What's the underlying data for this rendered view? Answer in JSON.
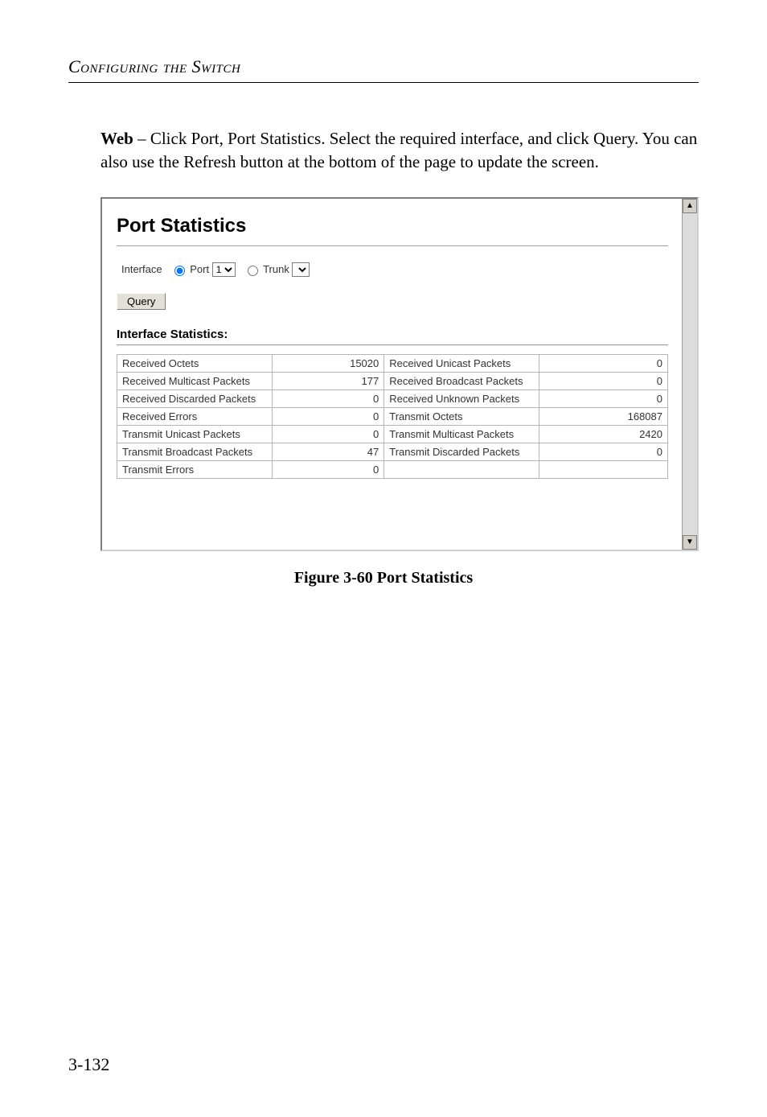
{
  "header": {
    "title": "Configuring the Switch"
  },
  "body": {
    "lead": "Web",
    "text": " – Click Port, Port Statistics. Select the required interface, and click Query. You can also use the Refresh button at the bottom of the page to update the screen."
  },
  "ui": {
    "heading": "Port Statistics",
    "interface_label": "Interface",
    "port_radio_label": "Port",
    "port_select_value": "1",
    "trunk_radio_label": "Trunk",
    "trunk_select_value": "",
    "query_button": "Query",
    "section_heading": "Interface Statistics:",
    "stats_rows": [
      {
        "l1": "Received Octets",
        "v1": "15020",
        "l2": "Received Unicast Packets",
        "v2": "0"
      },
      {
        "l1": "Received Multicast Packets",
        "v1": "177",
        "l2": "Received Broadcast Packets",
        "v2": "0"
      },
      {
        "l1": "Received Discarded Packets",
        "v1": "0",
        "l2": "Received Unknown Packets",
        "v2": "0"
      },
      {
        "l1": "Received Errors",
        "v1": "0",
        "l2": "Transmit Octets",
        "v2": "168087"
      },
      {
        "l1": "Transmit Unicast Packets",
        "v1": "0",
        "l2": "Transmit Multicast Packets",
        "v2": "2420"
      },
      {
        "l1": "Transmit Broadcast Packets",
        "v1": "47",
        "l2": "Transmit Discarded Packets",
        "v2": "0"
      },
      {
        "l1": "Transmit Errors",
        "v1": "0",
        "l2": "",
        "v2": ""
      }
    ]
  },
  "caption": "Figure 3-60  Port Statistics",
  "page_number": "3-132"
}
